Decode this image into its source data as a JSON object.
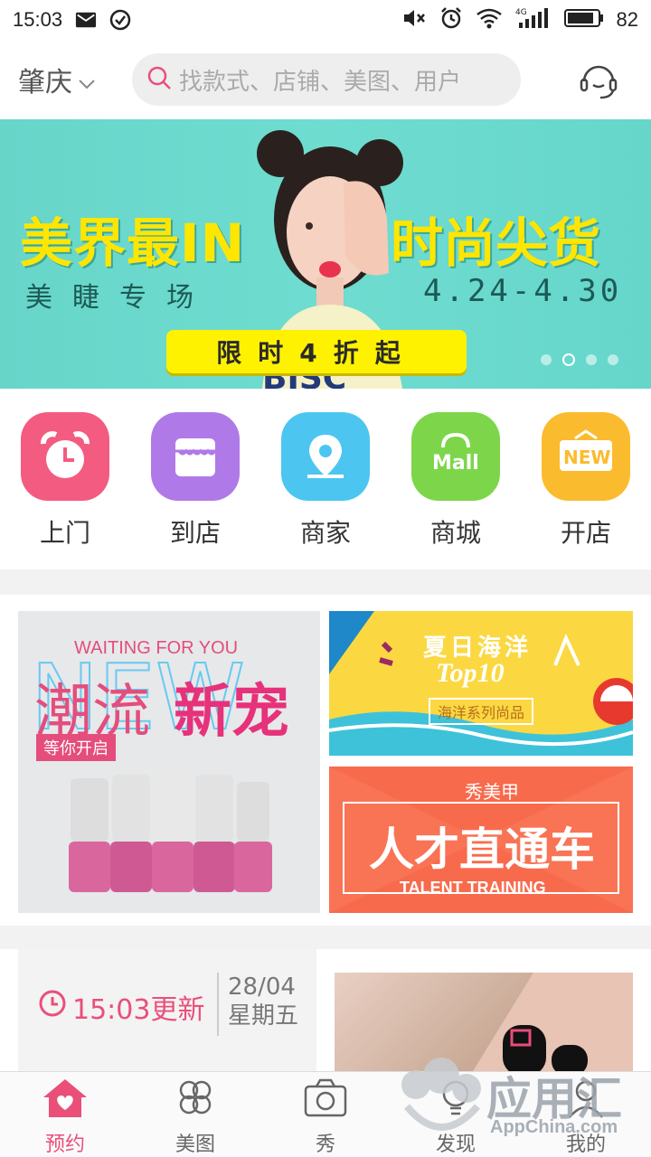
{
  "statusbar": {
    "time": "15:03",
    "battery": "82",
    "network": "4G"
  },
  "topbar": {
    "city": "肇庆",
    "search_placeholder": "找款式、店铺、美图、用户"
  },
  "banner": {
    "title_left": "美界最IN",
    "title_right": "时尚尖货",
    "subtitle": "美睫专场",
    "date": "4.24-4.30",
    "cta": "限时4折起",
    "slide_count": 4,
    "active_slide": 2
  },
  "quick_menu": [
    {
      "label": "上门",
      "color": "#f45b80",
      "icon": "alarm-clock-icon"
    },
    {
      "label": "到店",
      "color": "#b079e8",
      "icon": "store-icon"
    },
    {
      "label": "商家",
      "color": "#4cc6f0",
      "icon": "location-pin-icon"
    },
    {
      "label": "商城",
      "color": "#7dd64a",
      "icon": "mall-bag-icon"
    },
    {
      "label": "开店",
      "color": "#fbbb2e",
      "icon": "new-shop-icon"
    }
  ],
  "promo": {
    "left": {
      "tagline": "WAITING FOR YOU",
      "title_a": "潮流",
      "title_b": "新宠",
      "tag": "等你开启",
      "bg_word": "NEW"
    },
    "top_right": {
      "title": "夏日海洋",
      "sub": "Top10",
      "caption": "海洋系列尚品"
    },
    "bottom_right": {
      "brand": "秀美甲",
      "title": "人才直通车",
      "sub": "TALENT TRAINING"
    }
  },
  "update": {
    "time_label": "15:03更新",
    "date": "28/04",
    "weekday": "星期五"
  },
  "bottom_nav": [
    {
      "label": "预约",
      "icon": "home-heart-icon",
      "active": true
    },
    {
      "label": "美图",
      "icon": "clover-icon",
      "active": false
    },
    {
      "label": "秀",
      "icon": "camera-icon",
      "active": false
    },
    {
      "label": "发现",
      "icon": "bulb-icon",
      "active": false
    },
    {
      "label": "我的",
      "icon": "person-icon",
      "active": false
    }
  ],
  "watermark": {
    "title": "应用汇",
    "sub": "AppChina.com"
  },
  "colors": {
    "accent": "#ea4f7a",
    "banner_bg": "#67d8cc",
    "banner_yellow": "#ffe600"
  }
}
